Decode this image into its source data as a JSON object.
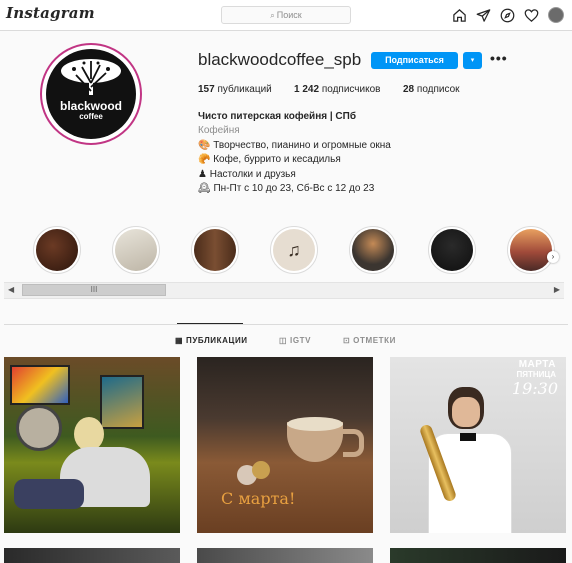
{
  "app": {
    "logo_text": "Instagram"
  },
  "search": {
    "placeholder": "Поиск"
  },
  "nav": {
    "icons": [
      "home-icon",
      "direct-icon",
      "explore-icon",
      "heart-icon",
      "avatar"
    ]
  },
  "profile": {
    "username": "blackwoodcoffee_spb",
    "avatar_brand": "blackwood",
    "avatar_sub": "coffee",
    "follow_label": "Подписаться",
    "dropdown_label": "▾",
    "more_label": "•••",
    "stats": {
      "posts": {
        "count": "157",
        "label": "публикаций"
      },
      "followers": {
        "count": "1 242",
        "label": "подписчиков"
      },
      "following": {
        "count": "28",
        "label": "подписок"
      }
    },
    "bio": {
      "full_name": "Чисто питерская кофейня | СПб",
      "category": "Кофейня",
      "lines": [
        {
          "emoji": "🎨",
          "text": "Творчество, пианино и огромные окна"
        },
        {
          "emoji": "🥐",
          "text": "Кофе, буррито и кесадилья"
        },
        {
          "emoji": "♟",
          "text": "Настолки и друзья"
        },
        {
          "emoji": "🕰",
          "text": "Пн-Пт с 10 до 23, Сб-Вс с 12 до 23"
        }
      ]
    }
  },
  "highlights": [
    {
      "name": "highlight-1",
      "color": "#4a2a1c"
    },
    {
      "name": "highlight-2",
      "color": "#d9d4c8"
    },
    {
      "name": "highlight-3",
      "color": "#5b3a26"
    },
    {
      "name": "highlight-4",
      "color": "#e6ddd1"
    },
    {
      "name": "highlight-5",
      "color": "#3b3530"
    },
    {
      "name": "highlight-6",
      "color": "#151515"
    },
    {
      "name": "highlight-7",
      "color": "#a04a3a"
    }
  ],
  "scrollbar": {
    "left_arrow": "◀",
    "right_arrow": "▶",
    "thumb_grip": "III"
  },
  "tabs": [
    {
      "label": "ПУБЛИКАЦИИ",
      "icon": "grid-icon",
      "active": true
    },
    {
      "label": "IGTV",
      "icon": "igtv-icon",
      "active": false
    },
    {
      "label": "ОТМЕТКИ",
      "icon": "tag-icon",
      "active": false
    }
  ],
  "posts": [
    {
      "name": "post-reading-woman"
    },
    {
      "name": "post-coffee-cup",
      "caption": "С марта!"
    },
    {
      "name": "post-saxophonist",
      "caption_line1": "МАРТА",
      "caption_line2": "ПЯТНИЦА",
      "caption_time": "19:30"
    }
  ],
  "colors": {
    "accent": "#0095f6",
    "avatar_ring": "#c13584"
  }
}
